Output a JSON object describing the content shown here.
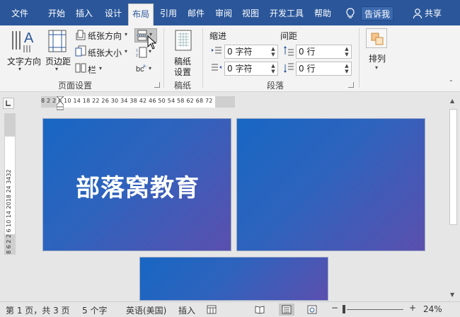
{
  "tabs": [
    {
      "label": "文件",
      "active": false
    },
    {
      "label": "开始",
      "active": false
    },
    {
      "label": "插入",
      "active": false
    },
    {
      "label": "设计",
      "active": false
    },
    {
      "label": "布局",
      "active": true
    },
    {
      "label": "引用",
      "active": false
    },
    {
      "label": "邮件",
      "active": false
    },
    {
      "label": "审阅",
      "active": false
    },
    {
      "label": "视图",
      "active": false
    },
    {
      "label": "开发工具",
      "active": false
    },
    {
      "label": "帮助",
      "active": false
    }
  ],
  "tell_me": "告诉我",
  "share": "共享",
  "ribbon": {
    "text_direction": "文字方向",
    "margins": "页边距",
    "orientation": "纸张方向",
    "size": "纸张大小",
    "columns": "栏",
    "page_setup_group": "页面设置",
    "draft_paper": "稿纸\n设置",
    "draft_line1": "稿纸",
    "draft_line2": "设置",
    "draft_group": "稿纸",
    "indent": "缩进",
    "spacing": "间距",
    "indent_left": "0 字符",
    "indent_right": "0 字符",
    "spacing_before": "0 行",
    "spacing_after": "0 行",
    "paragraph_group": "段落",
    "arrange": "排列"
  },
  "ruler": {
    "horizontal": "8  2   2   6  10 14 18 22 26 30 34 38 42 46 50 54 58 62   68 72",
    "vertical": "8 6   2   2   6  10  14  2018  24    3432"
  },
  "document": {
    "title": "部落窝教育"
  },
  "status": {
    "page_info": "第 1 页，共 3 页",
    "word_count": "5 个字",
    "language": "英语(美国)",
    "mode": "插入",
    "zoom": "24%"
  },
  "colors": {
    "accent": "#2b579a",
    "page_start": "#1767c3",
    "page_end": "#5b4fae"
  }
}
